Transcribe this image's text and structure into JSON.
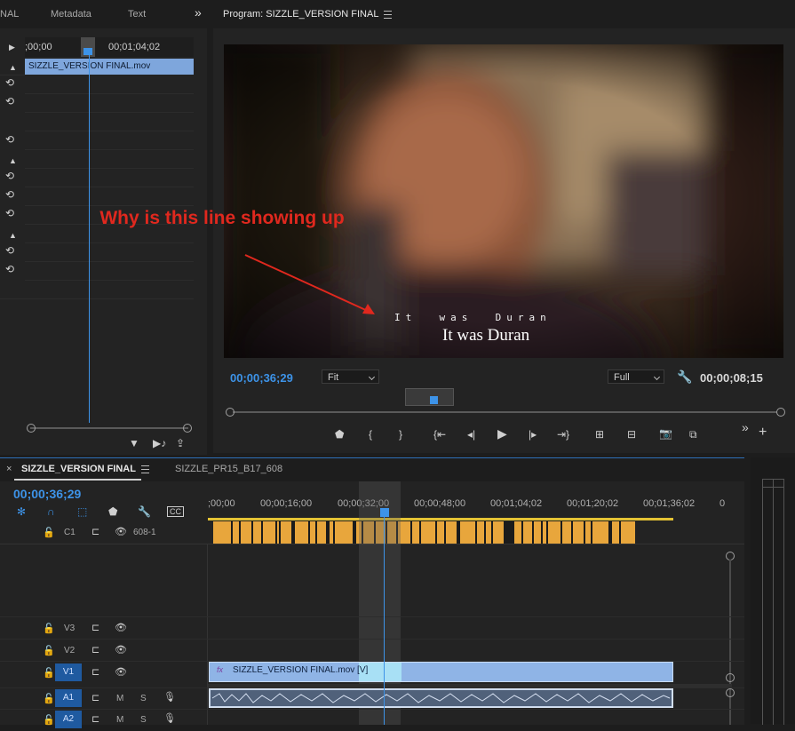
{
  "source_panel": {
    "tabs": [
      "NAL",
      "Metadata",
      "Text"
    ],
    "overflow": "»",
    "timecode_start": ";00;00",
    "timecode_end": "00;01;04;02",
    "clip_name": "SIZZLE_VERSION FINAL.mov"
  },
  "program_monitor": {
    "title": "Program: SIZZLE_VERSION FINAL",
    "subtitle_spaced": "It  was  Duran",
    "subtitle": "It was Duran",
    "annotation": "Why is this line showing up",
    "timecode": "00;00;36;29",
    "fit_option": "Fit",
    "quality_option": "Full",
    "duration": "00;00;08;15"
  },
  "timeline": {
    "tabs": [
      "SIZZLE_VERSION FINAL",
      "SIZZLE_PR15_B17_608"
    ],
    "timecode": "00;00;36;29",
    "ruler": [
      ";00;00",
      "00;00;16;00",
      "00;00;32;00",
      "00;00;48;00",
      "00;01;04;02",
      "00;01;20;02",
      "00;01;36;02",
      "0"
    ],
    "caption_track": {
      "label": "C1",
      "name": "608-1"
    },
    "tracks": [
      {
        "label": "V3",
        "active": false
      },
      {
        "label": "V2",
        "active": false
      },
      {
        "label": "V1",
        "active": true
      },
      {
        "label": "A1",
        "active": true,
        "mute": "M",
        "solo": "S"
      },
      {
        "label": "A2",
        "active": true,
        "mute": "M",
        "solo": "S"
      }
    ],
    "video_clip": "SIZZLE_VERSION FINAL.mov [V]",
    "fx_badge": "fx"
  },
  "colors": {
    "accent": "#3d93e8",
    "caption": "#e8a63c",
    "clip": "#8fb4e6",
    "annotation": "#e0281e"
  }
}
